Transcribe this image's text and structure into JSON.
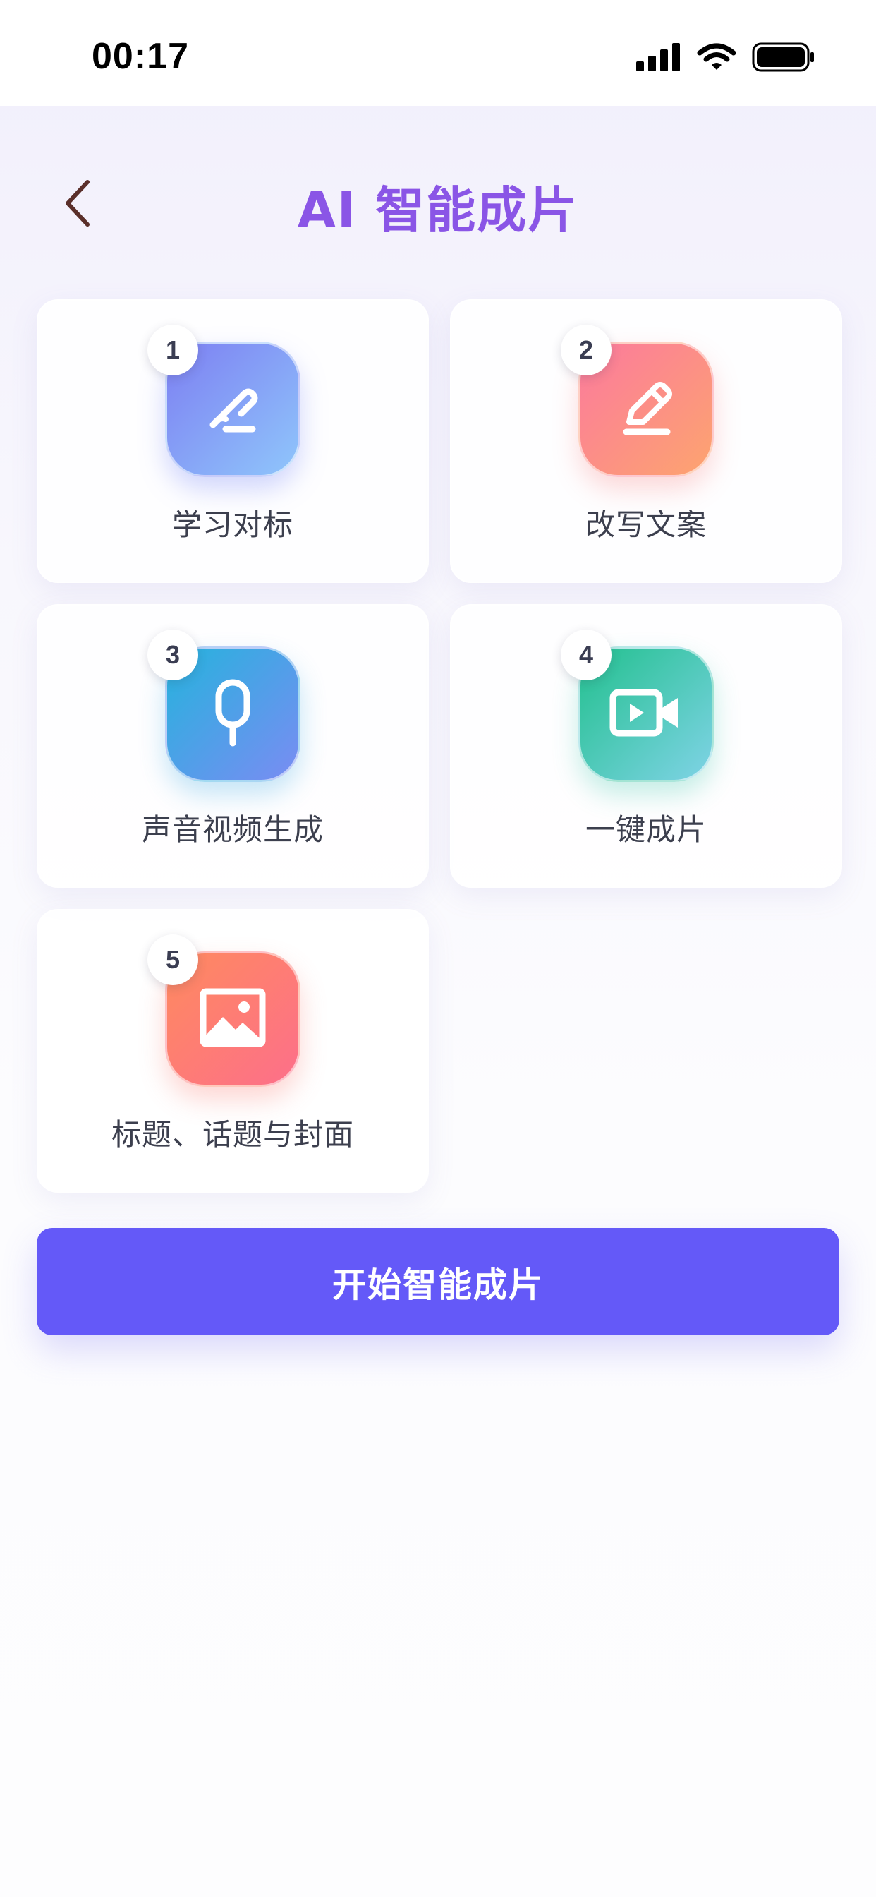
{
  "status_bar": {
    "time": "00:17",
    "icons": [
      "cellular-signal-icon",
      "wifi-icon",
      "battery-icon"
    ]
  },
  "header": {
    "back_icon": "chevron-left-icon",
    "title": "AI 智能成片"
  },
  "steps": [
    {
      "number": "1",
      "label": "学习对标",
      "icon": "signature-pen-icon"
    },
    {
      "number": "2",
      "label": "改写文案",
      "icon": "pencil-edit-icon"
    },
    {
      "number": "3",
      "label": "声音视频生成",
      "icon": "microphone-icon"
    },
    {
      "number": "4",
      "label": "一键成片",
      "icon": "video-camera-icon"
    },
    {
      "number": "5",
      "label": "标题、话题与封面",
      "icon": "image-icon"
    }
  ],
  "actions": {
    "start_label": "开始智能成片"
  },
  "colors": {
    "title": "#8a55e6",
    "primary_button": "#6459f8",
    "back_icon": "#5a2f2a"
  }
}
